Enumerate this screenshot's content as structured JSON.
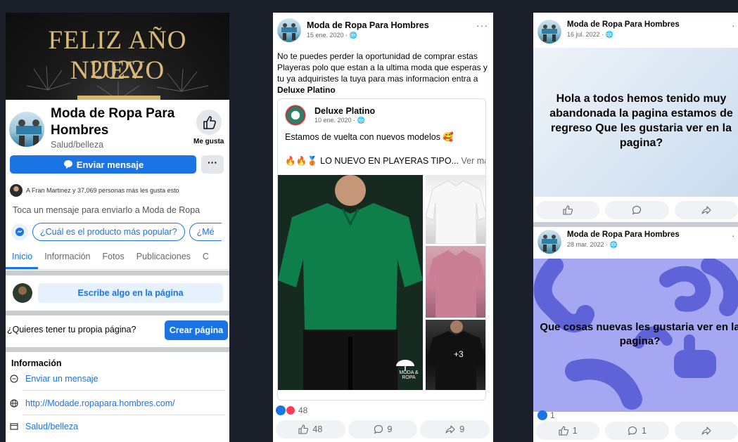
{
  "panel1": {
    "cover_line1": "FELIZ AÑO NUEVO",
    "cover_line2": "2022",
    "page_name": "Moda de Ropa Para Hombres",
    "category": "Salud/belleza",
    "like_label": "Me gusta",
    "send_message": "Enviar mensaje",
    "more": "···",
    "friends_like": "A Fran Martinez y 37,069 personas más les gusta esto",
    "touch_hint": "Toca un mensaje para enviarlo a Moda de Ropa",
    "chips": [
      "¿Cuál es el producto más popular?",
      "¿Mé"
    ],
    "tabs": [
      "Inicio",
      "Información",
      "Fotos",
      "Publicaciones",
      "C"
    ],
    "write_prompt": "Escribe algo en la página",
    "own_page_question": "¿Quieres tener tu propia página?",
    "create_page": "Crear página",
    "info_heading": "Información",
    "info_send": "Enviar un mensaje",
    "info_website": "http://Modade.ropapara.hombres.com/",
    "info_category": "Salud/belleza",
    "accent": "#1b74e4"
  },
  "panel2": {
    "name": "Moda de Ropa Para Hombres",
    "date": "15 ene. 2020 · 🌐",
    "more": "···",
    "text": "No te puedes perder la oportunidad de comprar estas Playeras polo que estan a la ultima moda que esperas y tu ya adquiristes la tuya para mas informacion entra a ",
    "text_bold": "Deluxe Platino",
    "shared_name": "Deluxe Platino",
    "shared_date": "10 ene. 2020 · 🌐",
    "shared_text1": "Estamos de vuelta con nuevos modelos 🥰",
    "shared_text2": "🔥🔥🥉 LO NUEVO EN PLAYERAS TIPO... ",
    "see_more": "Ver más",
    "extra_photos": "+3",
    "watermark": "MODA & ROPA",
    "reaction_count": "48",
    "like_count": "48",
    "comment_count": "9",
    "share_count": "9"
  },
  "panel3": {
    "post1": {
      "name": "Moda de Ropa Para Hombres",
      "date": "16 jul. 2022 · 🌐",
      "text": "Hola a todos hemos tenido muy abandonada la pagina estamos de regreso Que les gustaria ver en la pagina?"
    },
    "post2": {
      "name": "Moda de Ropa Para Hombres",
      "date": "28 mar. 2022 · 🌐",
      "text": "Que cosas nuevas les gustaria ver en la pagina?",
      "reaction_count": "1",
      "like_count": "1",
      "comment_count": "1"
    },
    "more": "·"
  }
}
